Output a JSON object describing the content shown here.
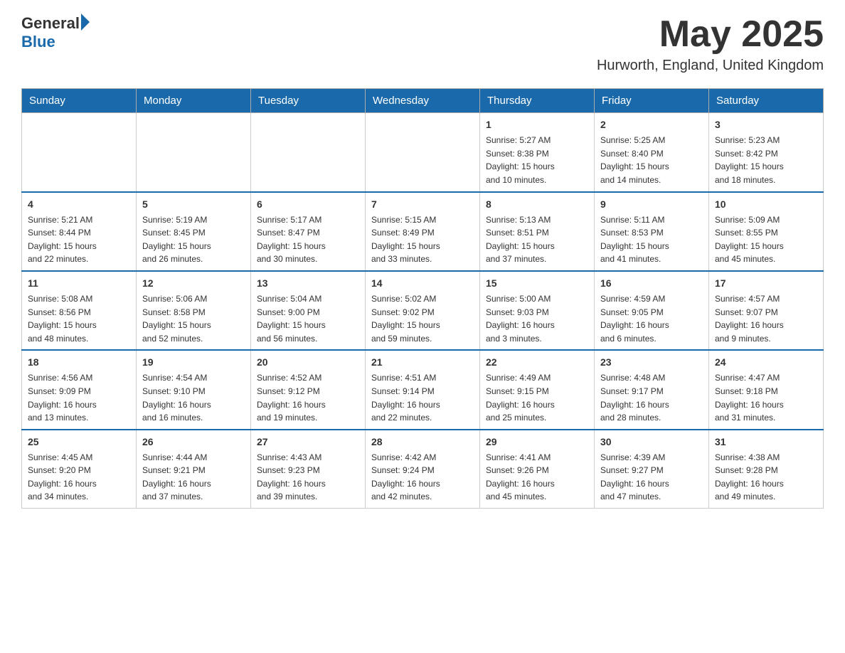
{
  "header": {
    "logo_general": "General",
    "logo_blue": "Blue",
    "month_title": "May 2025",
    "location": "Hurworth, England, United Kingdom"
  },
  "days_of_week": [
    "Sunday",
    "Monday",
    "Tuesday",
    "Wednesday",
    "Thursday",
    "Friday",
    "Saturday"
  ],
  "weeks": [
    [
      {
        "day": "",
        "info": ""
      },
      {
        "day": "",
        "info": ""
      },
      {
        "day": "",
        "info": ""
      },
      {
        "day": "",
        "info": ""
      },
      {
        "day": "1",
        "info": "Sunrise: 5:27 AM\nSunset: 8:38 PM\nDaylight: 15 hours\nand 10 minutes."
      },
      {
        "day": "2",
        "info": "Sunrise: 5:25 AM\nSunset: 8:40 PM\nDaylight: 15 hours\nand 14 minutes."
      },
      {
        "day": "3",
        "info": "Sunrise: 5:23 AM\nSunset: 8:42 PM\nDaylight: 15 hours\nand 18 minutes."
      }
    ],
    [
      {
        "day": "4",
        "info": "Sunrise: 5:21 AM\nSunset: 8:44 PM\nDaylight: 15 hours\nand 22 minutes."
      },
      {
        "day": "5",
        "info": "Sunrise: 5:19 AM\nSunset: 8:45 PM\nDaylight: 15 hours\nand 26 minutes."
      },
      {
        "day": "6",
        "info": "Sunrise: 5:17 AM\nSunset: 8:47 PM\nDaylight: 15 hours\nand 30 minutes."
      },
      {
        "day": "7",
        "info": "Sunrise: 5:15 AM\nSunset: 8:49 PM\nDaylight: 15 hours\nand 33 minutes."
      },
      {
        "day": "8",
        "info": "Sunrise: 5:13 AM\nSunset: 8:51 PM\nDaylight: 15 hours\nand 37 minutes."
      },
      {
        "day": "9",
        "info": "Sunrise: 5:11 AM\nSunset: 8:53 PM\nDaylight: 15 hours\nand 41 minutes."
      },
      {
        "day": "10",
        "info": "Sunrise: 5:09 AM\nSunset: 8:55 PM\nDaylight: 15 hours\nand 45 minutes."
      }
    ],
    [
      {
        "day": "11",
        "info": "Sunrise: 5:08 AM\nSunset: 8:56 PM\nDaylight: 15 hours\nand 48 minutes."
      },
      {
        "day": "12",
        "info": "Sunrise: 5:06 AM\nSunset: 8:58 PM\nDaylight: 15 hours\nand 52 minutes."
      },
      {
        "day": "13",
        "info": "Sunrise: 5:04 AM\nSunset: 9:00 PM\nDaylight: 15 hours\nand 56 minutes."
      },
      {
        "day": "14",
        "info": "Sunrise: 5:02 AM\nSunset: 9:02 PM\nDaylight: 15 hours\nand 59 minutes."
      },
      {
        "day": "15",
        "info": "Sunrise: 5:00 AM\nSunset: 9:03 PM\nDaylight: 16 hours\nand 3 minutes."
      },
      {
        "day": "16",
        "info": "Sunrise: 4:59 AM\nSunset: 9:05 PM\nDaylight: 16 hours\nand 6 minutes."
      },
      {
        "day": "17",
        "info": "Sunrise: 4:57 AM\nSunset: 9:07 PM\nDaylight: 16 hours\nand 9 minutes."
      }
    ],
    [
      {
        "day": "18",
        "info": "Sunrise: 4:56 AM\nSunset: 9:09 PM\nDaylight: 16 hours\nand 13 minutes."
      },
      {
        "day": "19",
        "info": "Sunrise: 4:54 AM\nSunset: 9:10 PM\nDaylight: 16 hours\nand 16 minutes."
      },
      {
        "day": "20",
        "info": "Sunrise: 4:52 AM\nSunset: 9:12 PM\nDaylight: 16 hours\nand 19 minutes."
      },
      {
        "day": "21",
        "info": "Sunrise: 4:51 AM\nSunset: 9:14 PM\nDaylight: 16 hours\nand 22 minutes."
      },
      {
        "day": "22",
        "info": "Sunrise: 4:49 AM\nSunset: 9:15 PM\nDaylight: 16 hours\nand 25 minutes."
      },
      {
        "day": "23",
        "info": "Sunrise: 4:48 AM\nSunset: 9:17 PM\nDaylight: 16 hours\nand 28 minutes."
      },
      {
        "day": "24",
        "info": "Sunrise: 4:47 AM\nSunset: 9:18 PM\nDaylight: 16 hours\nand 31 minutes."
      }
    ],
    [
      {
        "day": "25",
        "info": "Sunrise: 4:45 AM\nSunset: 9:20 PM\nDaylight: 16 hours\nand 34 minutes."
      },
      {
        "day": "26",
        "info": "Sunrise: 4:44 AM\nSunset: 9:21 PM\nDaylight: 16 hours\nand 37 minutes."
      },
      {
        "day": "27",
        "info": "Sunrise: 4:43 AM\nSunset: 9:23 PM\nDaylight: 16 hours\nand 39 minutes."
      },
      {
        "day": "28",
        "info": "Sunrise: 4:42 AM\nSunset: 9:24 PM\nDaylight: 16 hours\nand 42 minutes."
      },
      {
        "day": "29",
        "info": "Sunrise: 4:41 AM\nSunset: 9:26 PM\nDaylight: 16 hours\nand 45 minutes."
      },
      {
        "day": "30",
        "info": "Sunrise: 4:39 AM\nSunset: 9:27 PM\nDaylight: 16 hours\nand 47 minutes."
      },
      {
        "day": "31",
        "info": "Sunrise: 4:38 AM\nSunset: 9:28 PM\nDaylight: 16 hours\nand 49 minutes."
      }
    ]
  ]
}
